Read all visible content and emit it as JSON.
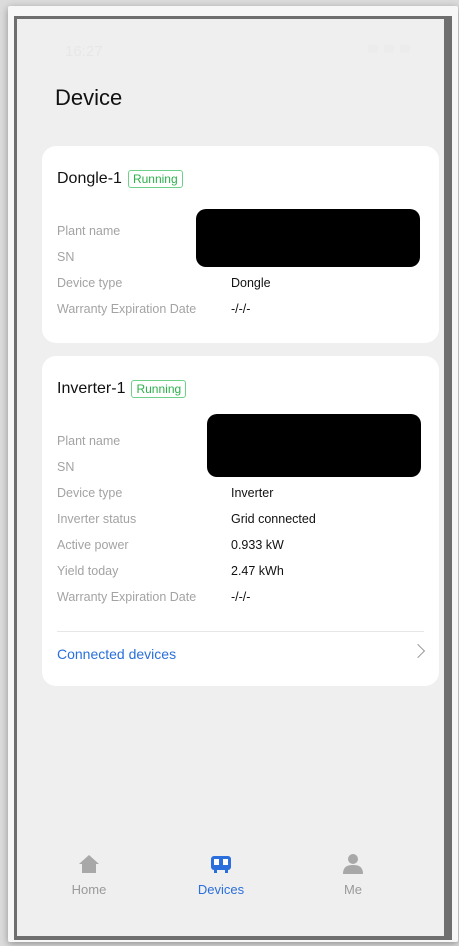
{
  "status_bar": {
    "time": "16:27"
  },
  "page": {
    "title": "Device"
  },
  "devices": [
    {
      "name": "Dongle-1",
      "status": "Running",
      "rows": [
        {
          "label": "Plant name",
          "value": ""
        },
        {
          "label": "SN",
          "value": ""
        },
        {
          "label": "Device type",
          "value": "Dongle"
        },
        {
          "label": "Warranty Expiration Date",
          "value": "-/-/-"
        }
      ]
    },
    {
      "name": "Inverter-1",
      "status": "Running",
      "rows": [
        {
          "label": "Plant name",
          "value": ""
        },
        {
          "label": "SN",
          "value": ""
        },
        {
          "label": "Device type",
          "value": "Inverter"
        },
        {
          "label": "Inverter status",
          "value": "Grid connected"
        },
        {
          "label": "Active power",
          "value": "0.933 kW"
        },
        {
          "label": "Yield today",
          "value": "2.47 kWh"
        },
        {
          "label": "Warranty Expiration Date",
          "value": "-/-/-"
        }
      ],
      "link": "Connected devices"
    }
  ],
  "tabs": [
    {
      "label": "Home",
      "icon": "home-icon"
    },
    {
      "label": "Devices",
      "icon": "devices-icon",
      "active": true
    },
    {
      "label": "Me",
      "icon": "person-icon"
    }
  ],
  "colors": {
    "accent": "#2a6fdb",
    "running_green": "#2bb04a",
    "tab_inactive": "#9a9a9a"
  }
}
